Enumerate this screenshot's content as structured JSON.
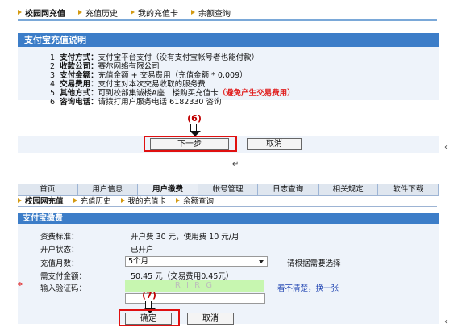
{
  "screen1": {
    "nav": [
      "校园网充值",
      "充值历史",
      "我的充值卡",
      "余额查询"
    ],
    "title": "支付宝充值说明",
    "info": [
      {
        "no": "1.",
        "label": "支付方式：",
        "text": "支付宝平台支付（没有支付宝帐号者也能付款）",
        "red": ""
      },
      {
        "no": "2.",
        "label": "收款公司：",
        "text": "赛尔网络有限公司",
        "red": ""
      },
      {
        "no": "3.",
        "label": "支付金额：",
        "text": "充值金额 + 交易费用（充值金额 * 0.009）",
        "red": ""
      },
      {
        "no": "4.",
        "label": "交易费用：",
        "text": "支付宝对本次交易收取的服务费",
        "red": ""
      },
      {
        "no": "5.",
        "label": "其他方式：",
        "text": "可到校部集诚楼A座二楼购买充值卡",
        "red": "（避免产生交易费用）"
      },
      {
        "no": "6.",
        "label": "咨询电话：",
        "text": "请拨打用户服务电话 6182330 咨询",
        "red": ""
      }
    ],
    "step_label": "(6)",
    "next_button": "下一步",
    "cancel_button": "取消",
    "cursor_mark": "↵",
    "edge_mark": "‹"
  },
  "screen2": {
    "tabs": [
      "首页",
      "用户信息",
      "用户缴费",
      "帐号管理",
      "日志查询",
      "相关规定",
      "软件下载"
    ],
    "active_tab": 2,
    "nav": [
      "校园网充值",
      "充值历史",
      "我的充值卡",
      "余额查询"
    ],
    "title": "支付宝缴费",
    "fields": {
      "fee_label": "资费标准：",
      "fee_value": "开户费 30 元，使用费 10 元/月",
      "status_label": "开户状态：",
      "status_value": "已开户",
      "months_label": "充值月数：",
      "months_value": "5个月",
      "months_hint": "请根据需要选择",
      "amount_label": "需支付金额：",
      "amount_value": "50.45 元（交易费用0.45元）",
      "captcha_label": "输入验证码：",
      "captcha_text": "R I R G",
      "refresh_link": "看不清楚，换一张",
      "required_star": "*"
    },
    "step_label": "(7)",
    "confirm_button": "确定",
    "cancel_button": "取消",
    "edge_mark": "‹"
  },
  "colors": {
    "title_bar": "#3c7dc8",
    "panel": "#eef3fa",
    "highlight": "#e01010",
    "step_label": "#c00000",
    "captcha_bg": "#c7f6b0"
  }
}
